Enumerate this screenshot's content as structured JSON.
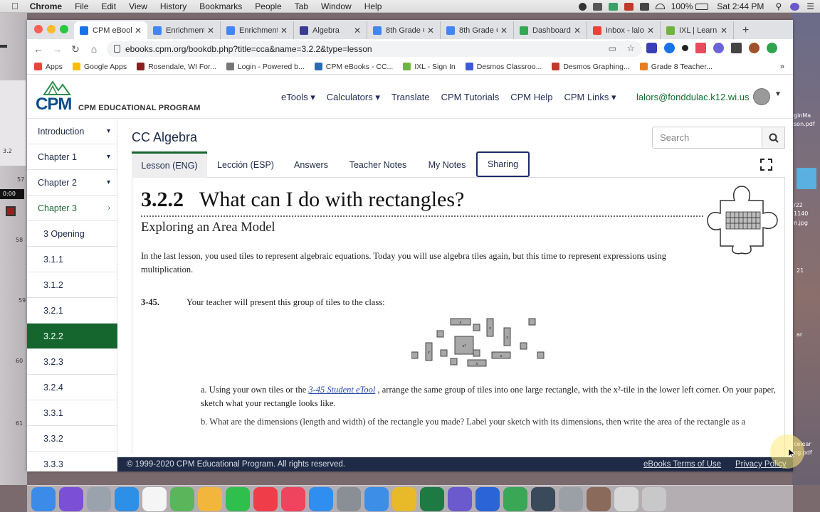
{
  "menubar": {
    "apple": "",
    "app": "Chrome",
    "items": [
      "File",
      "Edit",
      "View",
      "History",
      "Bookmarks",
      "People",
      "Tab",
      "Window",
      "Help"
    ],
    "battery": "100%",
    "clock": "Sat 2:44 PM"
  },
  "tabs": [
    {
      "title": "CPM eBook",
      "color": "#1a73e8",
      "active": true
    },
    {
      "title": "Enrichment",
      "color": "#4285f4"
    },
    {
      "title": "Enrichment",
      "color": "#4285f4"
    },
    {
      "title": "Algebra",
      "color": "#3b3b8f"
    },
    {
      "title": "8th Grade C",
      "color": "#4285f4"
    },
    {
      "title": "8th Grade C",
      "color": "#4285f4"
    },
    {
      "title": "Dashboard",
      "color": "#34a853"
    },
    {
      "title": "Inbox - lalo",
      "color": "#ea4335"
    },
    {
      "title": "IXL | Learn",
      "color": "#6fb43f"
    }
  ],
  "new_tab": "+",
  "url": "ebooks.cpm.org/bookdb.php?title=cca&name=3.2.2&type=lesson",
  "bookmarks": [
    {
      "label": "Apps",
      "color": "#e8453c"
    },
    {
      "label": "Google Apps",
      "color": "#fbbc05"
    },
    {
      "label": "Rosendale, WI For...",
      "color": "#8b1e1e"
    },
    {
      "label": "Login - Powered b...",
      "color": "#777"
    },
    {
      "label": "CPM eBooks - CC...",
      "color": "#2a6db1"
    },
    {
      "label": "IXL - Sign In",
      "color": "#6fb43f"
    },
    {
      "label": "Desmos Classroo...",
      "color": "#3b5bdb"
    },
    {
      "label": "Desmos Graphing...",
      "color": "#c0392b"
    },
    {
      "label": "Grade 8 Teacher...",
      "color": "#e67e22"
    }
  ],
  "logo": {
    "brand": "CPM",
    "subtitle": "CPM EDUCATIONAL PROGRAM"
  },
  "topnav": [
    "eTools ▾",
    "Calculators ▾",
    "Translate",
    "CPM Tutorials",
    "CPM Help",
    "CPM Links ▾"
  ],
  "user_email": "lalors@fonddulac.k12.wi.us",
  "sidebar": [
    {
      "label": "Introduction",
      "caret": "▾"
    },
    {
      "label": "Chapter 1",
      "caret": "▾"
    },
    {
      "label": "Chapter 2",
      "caret": "▾"
    },
    {
      "label": "Chapter 3",
      "caret": "›"
    },
    {
      "label": "3 Opening"
    },
    {
      "label": "3.1.1"
    },
    {
      "label": "3.1.2"
    },
    {
      "label": "3.2.1"
    },
    {
      "label": "3.2.2"
    },
    {
      "label": "3.2.3"
    },
    {
      "label": "3.2.4"
    },
    {
      "label": "3.3.1"
    },
    {
      "label": "3.3.2"
    },
    {
      "label": "3.3.3"
    }
  ],
  "book_title": "CC Algebra",
  "search_placeholder": "Search",
  "content_tabs": [
    "Lesson (ENG)",
    "Lección (ESP)",
    "Answers",
    "Teacher Notes",
    "My Notes",
    "Sharing"
  ],
  "lesson": {
    "number": "3.2.2",
    "title": "What can I do with rectangles?",
    "subtitle": "Exploring an Area Model",
    "intro": "In the last lesson, you used tiles to represent algebraic equations.  Today you will use algebra tiles again, but this time to represent expressions using multiplication.",
    "problem_number": "3-45.",
    "problem_text": "Your teacher will present this group of tiles to the class:",
    "part_a_pre": "a. Using your own tiles or the ",
    "part_a_link": "3-45 Student eTool",
    "part_a_post": " , arrange the same group of tiles into one large rectangle, with the x²-tile in the lower left corner.  On your paper, sketch what your rectangle looks like.",
    "part_b": "b. What are the dimensions (length and width) of the rectangle you made?  Label your sketch with its dimensions, then write the area of the rectangle as a"
  },
  "tile_labels": {
    "x": "x",
    "x2": "x²"
  },
  "footer": {
    "copyright": "© 1999-2020 CPM Educational Program. All rights reserved.",
    "terms": "eBooks Terms of Use",
    "privacy": "Privacy Policy"
  },
  "desktop": {
    "left_labels": [
      "3.2",
      "57",
      "0:00",
      "58",
      "59",
      "60",
      "61"
    ],
    "right_labels": [
      "ginMa",
      "son.pdf",
      "/22",
      "1140",
      "n.jpg",
      "21",
      "ar",
      "celear",
      "ng.pdf"
    ]
  },
  "dock": [
    {
      "name": "finder",
      "color": "#3d8be8"
    },
    {
      "name": "siri",
      "color": "#7b4fd6"
    },
    {
      "name": "launchpad",
      "color": "#9aa3ad"
    },
    {
      "name": "safari",
      "color": "#2d8fe6"
    },
    {
      "name": "calendar",
      "color": "#f5f5f5"
    },
    {
      "name": "maps",
      "color": "#5bb55b"
    },
    {
      "name": "photos",
      "color": "#f2b63c"
    },
    {
      "name": "messages",
      "color": "#2fbf4c"
    },
    {
      "name": "news",
      "color": "#ef3e4a"
    },
    {
      "name": "music",
      "color": "#f0435e"
    },
    {
      "name": "appstore",
      "color": "#2f8ef0"
    },
    {
      "name": "preferences",
      "color": "#8a8f95"
    },
    {
      "name": "notes",
      "color": "#3c8ee6"
    },
    {
      "name": "chrome",
      "color": "#e8ba2a"
    },
    {
      "name": "excel",
      "color": "#1d7a43"
    },
    {
      "name": "app",
      "color": "#6a5acd"
    },
    {
      "name": "dropbox",
      "color": "#2a64d6"
    },
    {
      "name": "numbers",
      "color": "#3aa757"
    },
    {
      "name": "quicktime",
      "color": "#3a4a5a"
    },
    {
      "name": "help",
      "color": "#9aa0a6"
    },
    {
      "name": "photo",
      "color": "#8a6a5a"
    },
    {
      "name": "files",
      "color": "#d8d8d8"
    },
    {
      "name": "trash",
      "color": "#c8c8c8"
    }
  ]
}
